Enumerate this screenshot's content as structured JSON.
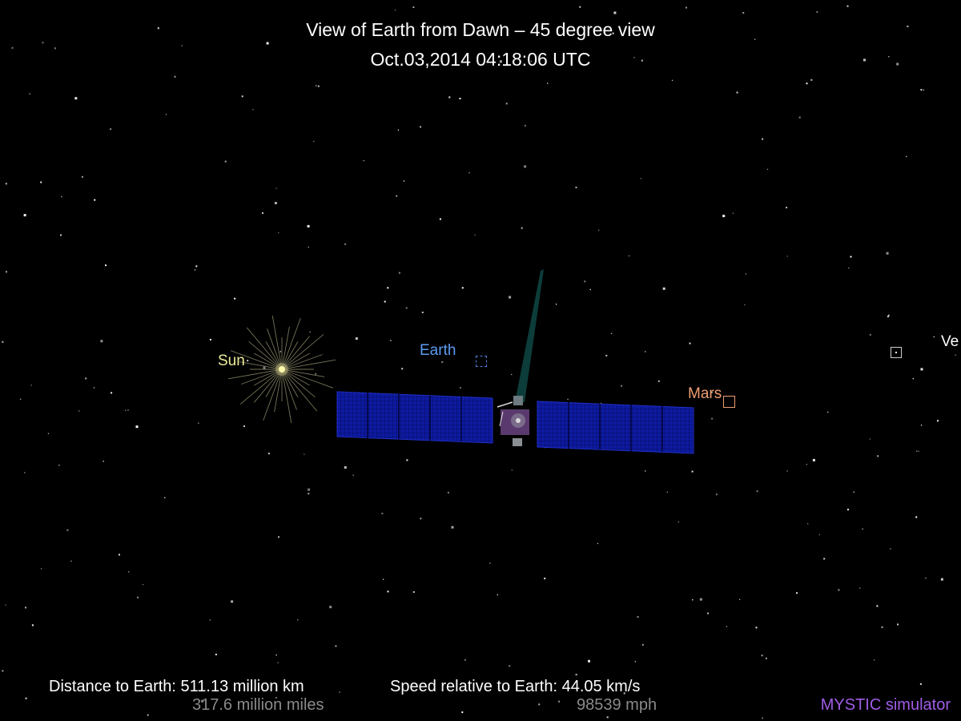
{
  "header": {
    "title": "View of Earth from Dawn – 45 degree view",
    "timestamp": "Oct.03,2014 04:18:06  UTC"
  },
  "bodies": {
    "sun": "Sun",
    "earth": "Earth",
    "mars": "Mars",
    "venus": "Ve"
  },
  "stats": {
    "distance_label": "Distance to Earth:",
    "distance_km": "511.13 million km",
    "distance_miles": "317.6 million miles",
    "speed_label": "Speed relative to Earth:",
    "speed_kms": "44.05 km/s",
    "speed_mph": "98539 mph"
  },
  "brand": "MYSTIC simulator",
  "colors": {
    "background": "#000000",
    "sun_label": "#ecec9c",
    "earth_label": "#5d9cf2",
    "mars_label": "#ef9e72",
    "brand": "#a05ce6",
    "secondary_text": "#8a8a8a",
    "solar_panel": "#0d1aa0",
    "antenna": "#0c3d3a"
  }
}
